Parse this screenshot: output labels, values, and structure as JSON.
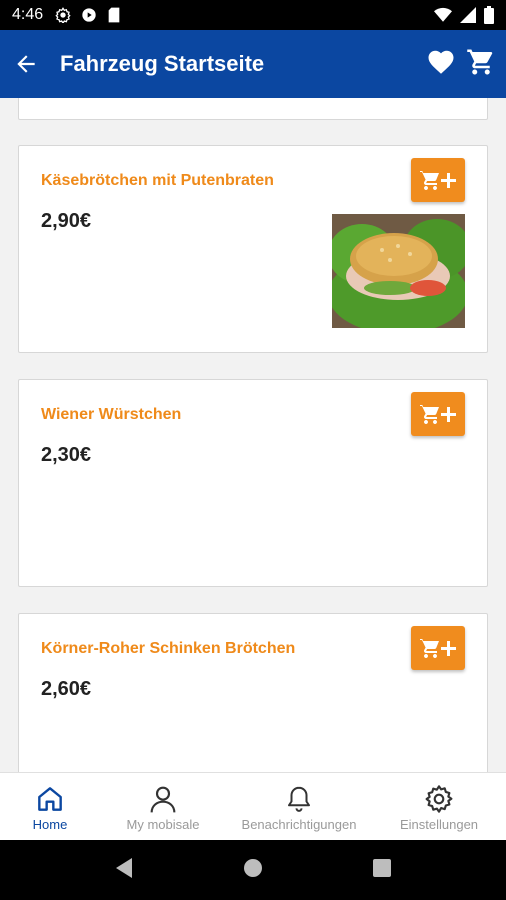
{
  "status_bar": {
    "time": "4:46"
  },
  "app_bar": {
    "title": "Fahrzeug Startseite"
  },
  "products": [
    {
      "name": "Käsebrötchen mit Putenbraten",
      "price": "2,90€",
      "has_image": true
    },
    {
      "name": "Wiener Würstchen",
      "price": "2,30€",
      "has_image": false
    },
    {
      "name": "Körner-Roher Schinken Brötchen",
      "price": "2,60€",
      "has_image": false
    }
  ],
  "bottom_nav": {
    "items": [
      {
        "label": "Home",
        "icon": "home-icon",
        "active": true
      },
      {
        "label": "My mobisale",
        "icon": "person-icon",
        "active": false
      },
      {
        "label": "Benachrichtigungen",
        "icon": "bell-icon",
        "active": false
      },
      {
        "label": "Einstellungen",
        "icon": "gear-icon",
        "active": false
      }
    ]
  },
  "colors": {
    "primary": "#0b47a1",
    "accent": "#f08c1e",
    "product_name": "#ef8a1a"
  }
}
